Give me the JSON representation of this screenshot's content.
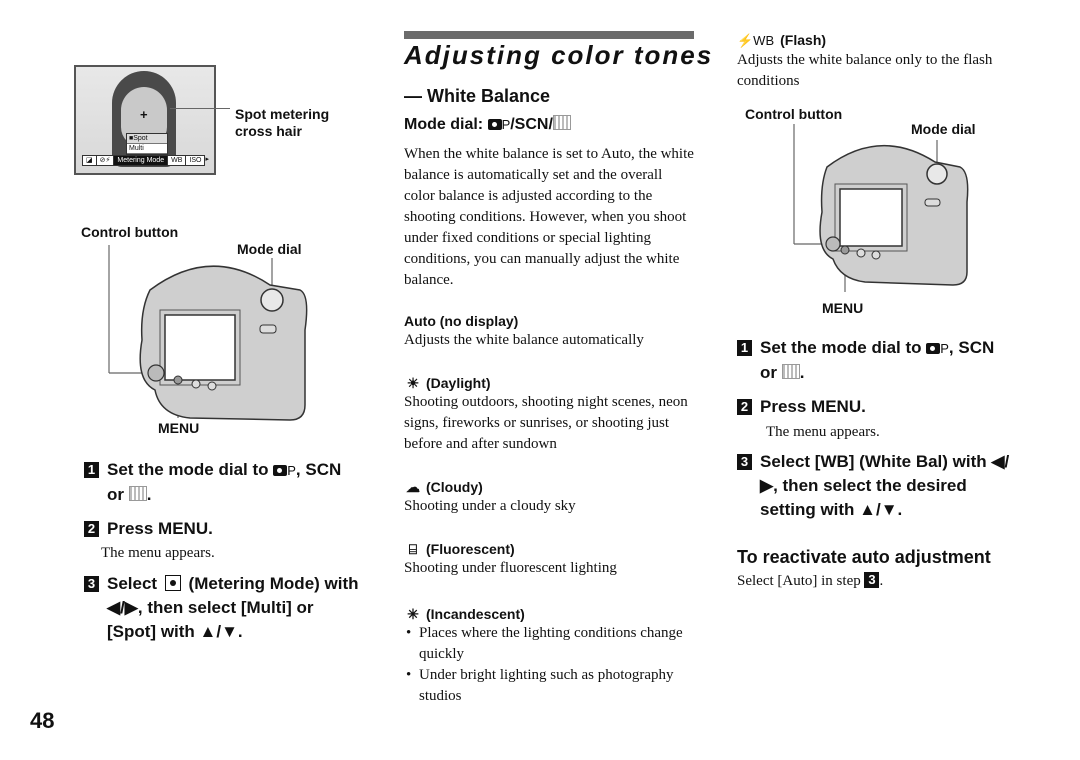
{
  "page_number": "48",
  "left": {
    "lcd": {
      "cross": "+",
      "menu_options": [
        "■Spot",
        "Multi"
      ],
      "bar_items": [
        "±",
        "ISO?",
        "Metering Mode",
        "WB",
        "ISO"
      ],
      "bar_icons": [
        "exposure-icon",
        "flash-icon"
      ]
    },
    "lcd_callout": "Spot metering\ncross hair",
    "camera_labels": {
      "control_button": "Control button",
      "mode_dial": "Mode dial",
      "menu": "MENU"
    },
    "steps": [
      {
        "num": "1",
        "text_pre": "Set the mode dial to ",
        "p": "P",
        "text_mid": ", SCN",
        "text_cont_pre": "or ",
        "text_cont_post": "."
      },
      {
        "num": "2",
        "text": "Press MENU.",
        "sub": "The menu appears."
      },
      {
        "num": "3",
        "text_pre": "Select ",
        "text_post": " (Metering Mode) with",
        "line2": "◀/▶, then select [Multi] or",
        "line3": "[Spot] with ▲/▼."
      }
    ]
  },
  "middle": {
    "title": "Adjusting color tones",
    "subtitle": "— White Balance",
    "mode_dial": {
      "prefix": "Mode dial: ",
      "p": "P",
      "suffix": "/SCN/"
    },
    "intro": "When the white balance is set to Auto, the white balance is automatically set and the overall color balance is adjusted according to the shooting conditions. However, when you shoot under fixed conditions or special lighting conditions, you can manually adjust the white balance.",
    "items": [
      {
        "icon": "",
        "icon_name": "none",
        "label": "Auto (no display)",
        "desc": "Adjusts the white balance automatically"
      },
      {
        "icon": "☀",
        "icon_name": "daylight-icon",
        "label": "(Daylight)",
        "desc": "Shooting outdoors, shooting night scenes, neon signs, fireworks or sunrises, or shooting just before and after sundown"
      },
      {
        "icon": "☁",
        "icon_name": "cloudy-icon",
        "label": "(Cloudy)",
        "desc": "Shooting under a cloudy sky"
      },
      {
        "icon": "⌸",
        "icon_name": "fluorescent-icon",
        "label": "(Fluorescent)",
        "desc": "Shooting under fluorescent lighting"
      },
      {
        "icon": "✳",
        "icon_name": "incandescent-icon",
        "label": "(Incandescent)",
        "bullets": [
          "Places where the lighting conditions change quickly",
          "Under bright lighting such as photography studios"
        ]
      }
    ]
  },
  "right": {
    "flash": {
      "icon": "⚡WB",
      "label": "(Flash)",
      "desc": "Adjusts the white balance only to the flash conditions"
    },
    "camera_labels": {
      "control_button": "Control button",
      "mode_dial": "Mode dial",
      "menu": "MENU"
    },
    "steps": [
      {
        "num": "1",
        "text_pre": "Set the mode dial to ",
        "p": "P",
        "text_mid": ", SCN",
        "text_cont_pre": "or ",
        "text_cont_post": "."
      },
      {
        "num": "2",
        "text": "Press MENU.",
        "sub": "The menu appears."
      },
      {
        "num": "3",
        "line1": "Select [WB] (White Bal) with ◀/",
        "line2": "▶, then select the desired",
        "line3": "setting with ▲/▼."
      }
    ],
    "reactivate": {
      "heading": "To reactivate auto adjustment",
      "text_pre": "Select [Auto] in step ",
      "step_ref": "3",
      "text_post": "."
    }
  }
}
